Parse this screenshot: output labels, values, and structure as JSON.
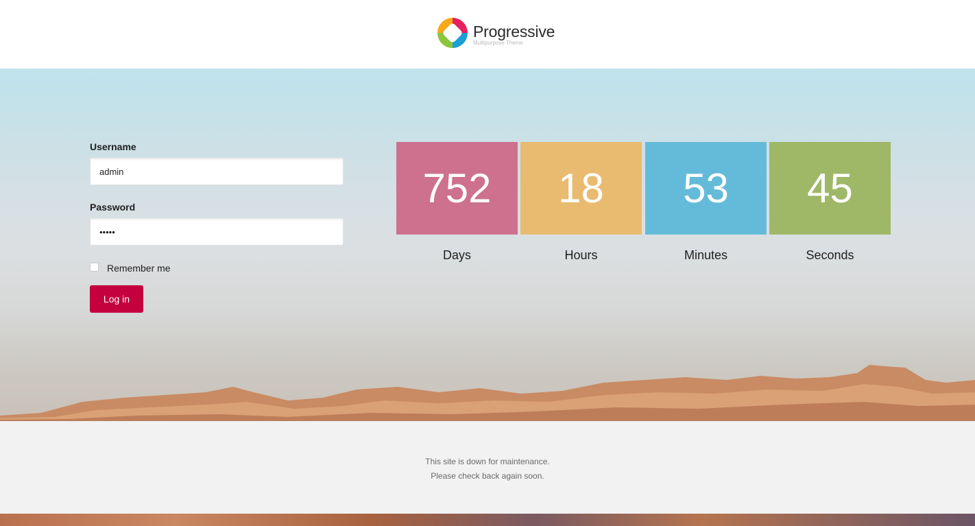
{
  "brand": {
    "name": "Progressive",
    "tagline": "Multipurpose Theme",
    "logo_colors": [
      "#e6215f",
      "#f7a81b",
      "#1a9fd6",
      "#8cc63f"
    ]
  },
  "login": {
    "username_label": "Username",
    "username_value": "admin",
    "password_label": "Password",
    "password_value": "•••••",
    "remember_label": "Remember me",
    "remember_checked": false,
    "submit_label": "Log in",
    "accent_color": "#c4003f"
  },
  "countdown": {
    "items": [
      {
        "value": "752",
        "label": "Days",
        "color": "#cd718f"
      },
      {
        "value": "18",
        "label": "Hours",
        "color": "#e8bb70"
      },
      {
        "value": "53",
        "label": "Minutes",
        "color": "#64bbd9"
      },
      {
        "value": "45",
        "label": "Seconds",
        "color": "#9fb868"
      }
    ]
  },
  "maintenance": {
    "line1": "This site is down for maintenance.",
    "line2": "Please check back again soon."
  }
}
